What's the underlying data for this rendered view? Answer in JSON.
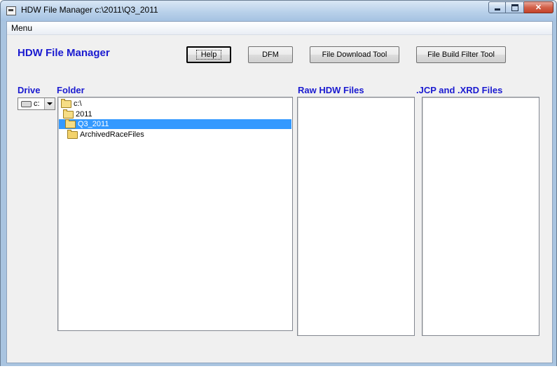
{
  "window": {
    "title": "HDW File Manager c:\\2011\\Q3_2011",
    "caption_buttons": {
      "minimize": "minimize-icon",
      "maximize": "maximize-icon",
      "close": "close-icon"
    }
  },
  "menu": {
    "label": "Menu"
  },
  "app_title": "HDW File Manager",
  "buttons": {
    "help": "Help",
    "dfm": "DFM",
    "download": "File Download Tool",
    "filter": "File Build Filter Tool"
  },
  "labels": {
    "drive": "Drive",
    "folder": "Folder",
    "raw": "Raw HDW Files",
    "jcp": ".JCP and .XRD Files"
  },
  "drive": {
    "selected": "c:",
    "icon": "drive-icon"
  },
  "folders": [
    {
      "name": "c:\\",
      "icon": "open-folder-icon",
      "selected": false
    },
    {
      "name": "2011",
      "icon": "open-folder-icon",
      "selected": false
    },
    {
      "name": "Q3_2011",
      "icon": "open-folder-icon",
      "selected": true
    },
    {
      "name": "ArchivedRaceFiles",
      "icon": "folder-icon",
      "selected": false
    }
  ],
  "raw_files": [],
  "jcp_files": [],
  "colors": {
    "accent_text": "#1a1ad0",
    "selection": "#3399ff"
  }
}
